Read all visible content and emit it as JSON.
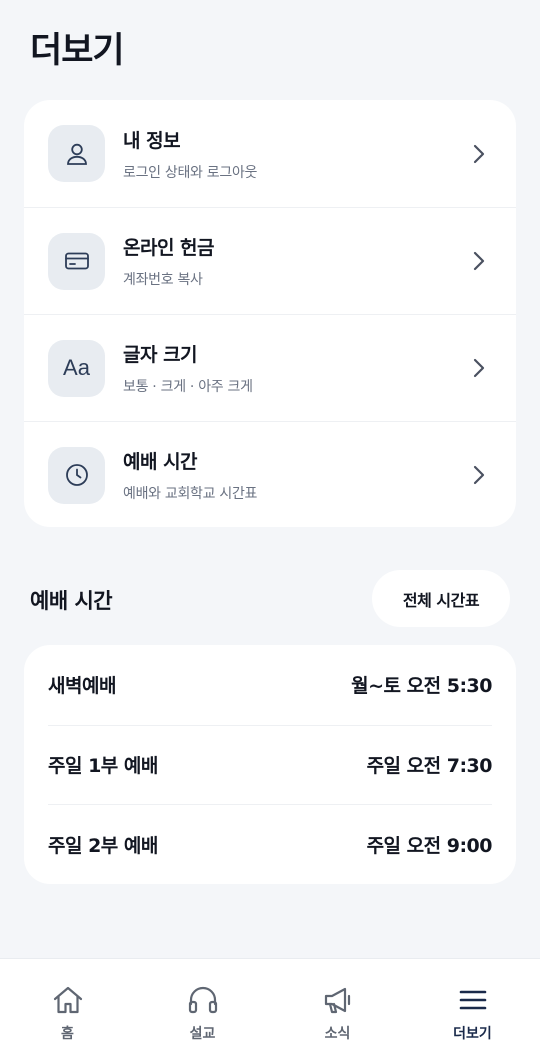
{
  "page": {
    "title": "더보기"
  },
  "menu": {
    "items": [
      {
        "title": "내 정보",
        "subtitle": "로그인 상태와 로그아웃",
        "icon": "user-icon"
      },
      {
        "title": "온라인 헌금",
        "subtitle": "계좌번호 복사",
        "icon": "card-icon"
      },
      {
        "title": "글자 크기",
        "subtitle": "보통 · 크게 · 아주 크게",
        "icon": "font-size-icon",
        "glyph": "Aa"
      },
      {
        "title": "예배 시간",
        "subtitle": "예배와 교회학교 시간표",
        "icon": "clock-icon"
      }
    ]
  },
  "worship": {
    "title": "예배 시간",
    "full_button": "전체 시간표",
    "rows": [
      {
        "name": "새벽예배",
        "time": "월~토 오전 5:30"
      },
      {
        "name": "주일 1부 예배",
        "time": "주일 오전 7:30"
      },
      {
        "name": "주일 2부 예배",
        "time": "주일 오전 9:00"
      }
    ]
  },
  "nav": {
    "items": [
      {
        "label": "홈",
        "icon": "home-icon"
      },
      {
        "label": "설교",
        "icon": "headphones-icon"
      },
      {
        "label": "소식",
        "icon": "megaphone-icon"
      },
      {
        "label": "더보기",
        "icon": "menu-icon",
        "active": true
      }
    ]
  },
  "colors": {
    "background": "#f4f6f9",
    "card": "#ffffff",
    "icon_bg": "#e8ecf1",
    "icon_stroke": "#2d3d58",
    "active_nav": "#1a2a4a"
  }
}
